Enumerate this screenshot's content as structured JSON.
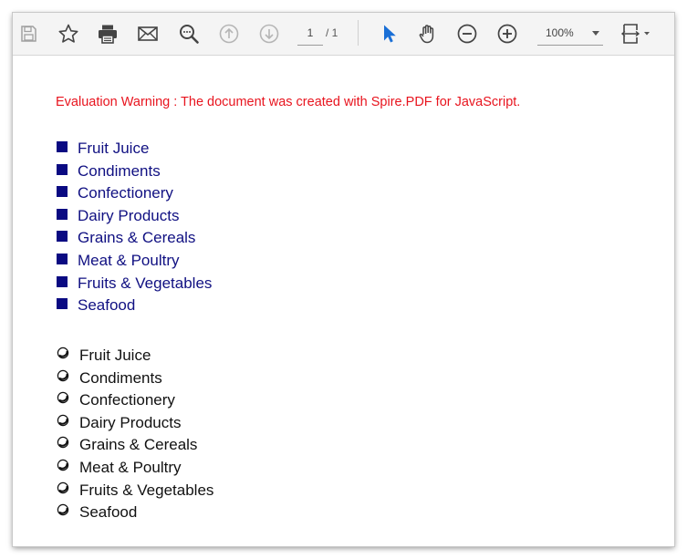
{
  "toolbar": {
    "buttons": {
      "save": "save-icon",
      "bookmark": "star-icon",
      "print": "printer-icon",
      "email": "mail-icon",
      "search": "search-icon",
      "prev_page": "arrow-up-circle-icon",
      "next_page": "arrow-down-circle-icon",
      "select": "cursor-icon",
      "pan": "hand-icon",
      "zoom_out": "minus-circle-icon",
      "zoom_in": "plus-circle-icon",
      "fit": "fit-page-icon"
    },
    "page_current": "1",
    "page_total": "/ 1",
    "zoom_value": "100%",
    "accent_color": "#1a6fd6"
  },
  "document": {
    "warning": "Evaluation Warning : The document was created with Spire.PDF for JavaScript.",
    "warning_color": "#e8141e",
    "square_list": {
      "color": "#101082",
      "items": [
        "Fruit Juice",
        "Condiments",
        "Confectionery",
        "Dairy Products",
        "Grains & Cereals",
        "Meat & Poultry",
        "Fruits & Vegetables",
        "Seafood"
      ]
    },
    "circle_list": {
      "color": "#111111",
      "items": [
        "Fruit Juice",
        "Condiments",
        "Confectionery",
        "Dairy Products",
        "Grains & Cereals",
        "Meat & Poultry",
        "Fruits & Vegetables",
        "Seafood"
      ]
    }
  }
}
